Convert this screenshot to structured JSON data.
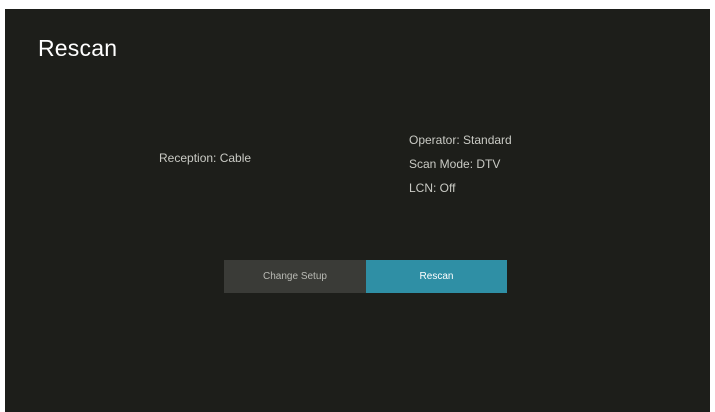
{
  "page": {
    "title": "Rescan"
  },
  "summary": {
    "reception": "Reception: Cable",
    "details": [
      "Operator: Standard",
      "Scan Mode: DTV",
      "LCN: Off"
    ]
  },
  "actions": {
    "change_setup_label": "Change Setup",
    "rescan_label": "Rescan",
    "focused": "rescan"
  },
  "colors": {
    "background": "#1d1e1a",
    "button_default": "#3a3b37",
    "button_focused": "#2f8fa5"
  }
}
